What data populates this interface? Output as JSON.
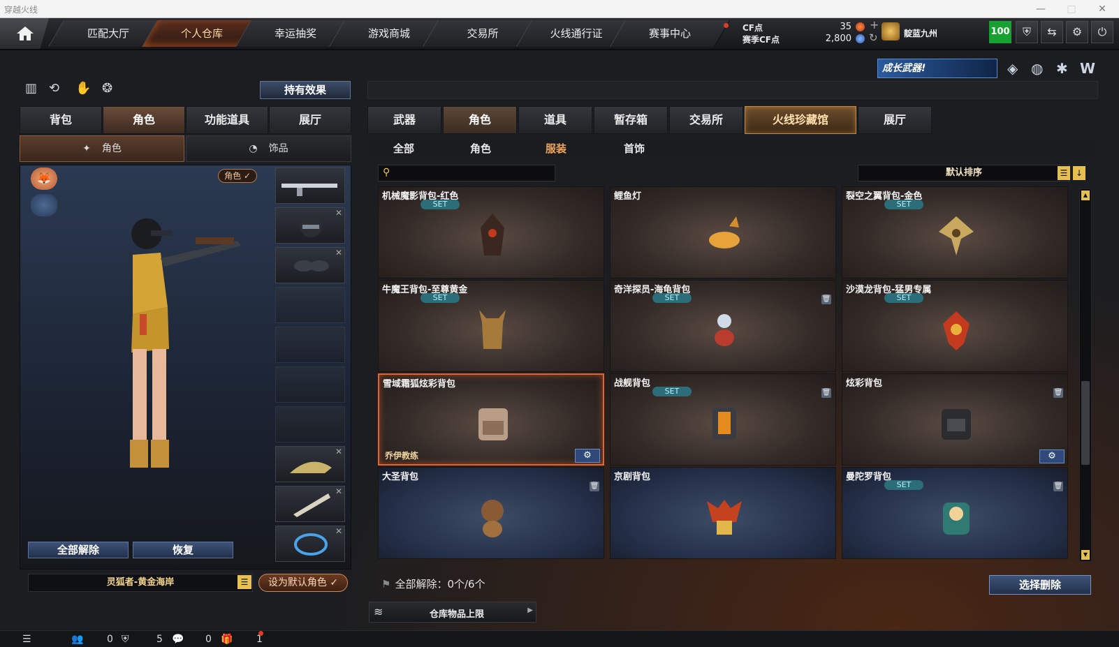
{
  "window": {
    "title": "穿越火线",
    "min": "—",
    "max": "□",
    "close": "✕"
  },
  "topnav": {
    "tabs": [
      "匹配大厅",
      "个人仓库",
      "幸运抽奖",
      "游戏商城",
      "交易所",
      "火线通行证",
      "赛事中心"
    ],
    "active_index": 1
  },
  "currency": {
    "cf_label": "CF点",
    "cf_value": "35",
    "event_label": "赛季CF点",
    "event_value": "2,800",
    "plus": "+",
    "refresh": "↻"
  },
  "user": {
    "name": "靛蓝九州",
    "level": "100"
  },
  "promo": {
    "text": "成长武器!"
  },
  "left": {
    "hold_effect": "持有效果",
    "tabs": [
      "背包",
      "角色",
      "功能道具",
      "展厅"
    ],
    "active_tab": 1,
    "subtabs": [
      "角色",
      "饰品"
    ],
    "role_tag": "角色 ✓",
    "unequip_all": "全部解除",
    "restore": "恢复",
    "character_name": "灵狐者-黄金海岸",
    "set_default": "设为默认角色 ✓"
  },
  "right": {
    "tabs": [
      "武器",
      "角色",
      "道具",
      "暂存箱",
      "交易所",
      "火线珍藏馆",
      "展厅"
    ],
    "active_tab": 1,
    "filters": [
      "全部",
      "角色",
      "服装",
      "首饰"
    ],
    "active_filter": 2,
    "search_placeholder": "",
    "sort_label": "默认排序",
    "items": [
      {
        "name": "机械魔影背包-红色",
        "set": "SET",
        "trash": false
      },
      {
        "name": "鲤鱼灯",
        "set": "",
        "trash": false
      },
      {
        "name": "裂空之翼背包-金色",
        "set": "SET",
        "trash": false
      },
      {
        "name": "牛魔王背包-至尊黄金",
        "set": "SET",
        "trash": false
      },
      {
        "name": "奇洋探员-海龟背包",
        "set": "SET",
        "trash": true
      },
      {
        "name": "沙漠龙背包-猛男专属",
        "set": "SET",
        "trash": false
      },
      {
        "name": "雪域霜狐炫彩背包",
        "set": "",
        "trash": false,
        "owner": "乔伊教练",
        "selected": true
      },
      {
        "name": "战舰背包",
        "set": "SET",
        "trash": true
      },
      {
        "name": "炫彩背包",
        "set": "",
        "trash": true
      },
      {
        "name": "大圣背包",
        "set": "",
        "trash": true
      },
      {
        "name": "京剧背包",
        "set": "",
        "trash": false
      },
      {
        "name": "曼陀罗背包",
        "set": "SET",
        "trash": true
      }
    ],
    "unequip_info": "全部解除：0个/6个",
    "select_delete": "选择删除",
    "storage_limit": "仓库物品上限"
  },
  "statusbar": {
    "friends": "0",
    "clan": "5",
    "messages": "0",
    "gifts": "1"
  },
  "colors": {
    "accent": "#e8622d",
    "level_bg": "#17a131",
    "set_badge": "#2c6d7a"
  }
}
